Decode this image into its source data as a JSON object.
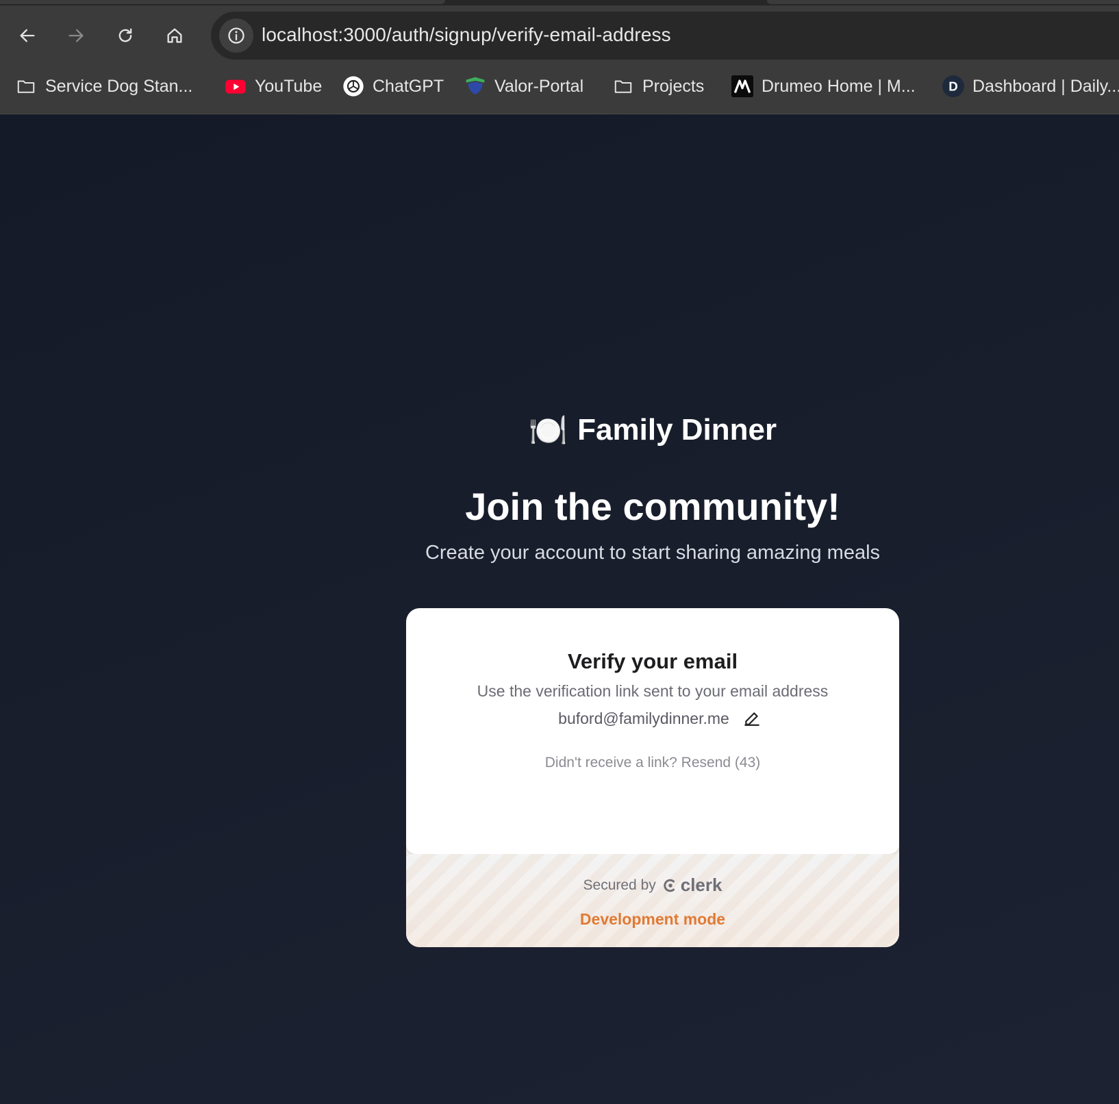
{
  "browser": {
    "url": "localhost:3000/auth/signup/verify-email-address",
    "nav": {
      "back": "back-arrow-icon",
      "forward": "forward-arrow-icon",
      "reload": "reload-icon",
      "home": "home-icon",
      "site_info": "info-icon"
    },
    "bookmarks": [
      {
        "label": "Service Dog Stan...",
        "icon": "folder-icon"
      },
      {
        "label": "YouTube",
        "icon": "youtube-icon"
      },
      {
        "label": "ChatGPT",
        "icon": "chatgpt-icon"
      },
      {
        "label": "Valor-Portal",
        "icon": "valor-shield-icon"
      },
      {
        "label": "Projects",
        "icon": "folder-icon"
      },
      {
        "label": "Drumeo Home | M...",
        "icon": "drumeo-icon"
      },
      {
        "label": "Dashboard | Daily...",
        "icon": "d-letter-icon",
        "icon_text": "D"
      }
    ]
  },
  "page": {
    "brand": {
      "emoji": "🍽️",
      "name": "Family Dinner"
    },
    "headline": "Join the community!",
    "subheadline": "Create your account to start sharing amazing meals",
    "card": {
      "title": "Verify your email",
      "description": "Use the verification link sent to your email address",
      "email": "buford@familydinner.me",
      "resend": "Didn't receive a link? Resend (43)",
      "footer": {
        "secured_by": "Secured by",
        "provider": "clerk",
        "mode": "Development mode"
      }
    }
  },
  "colors": {
    "page_bg": "#181d2b",
    "chrome_bg": "#3b3b3b",
    "omnibox_bg": "#282828",
    "dev_mode_accent": "#e07a34",
    "youtube_red": "#ff0033"
  }
}
